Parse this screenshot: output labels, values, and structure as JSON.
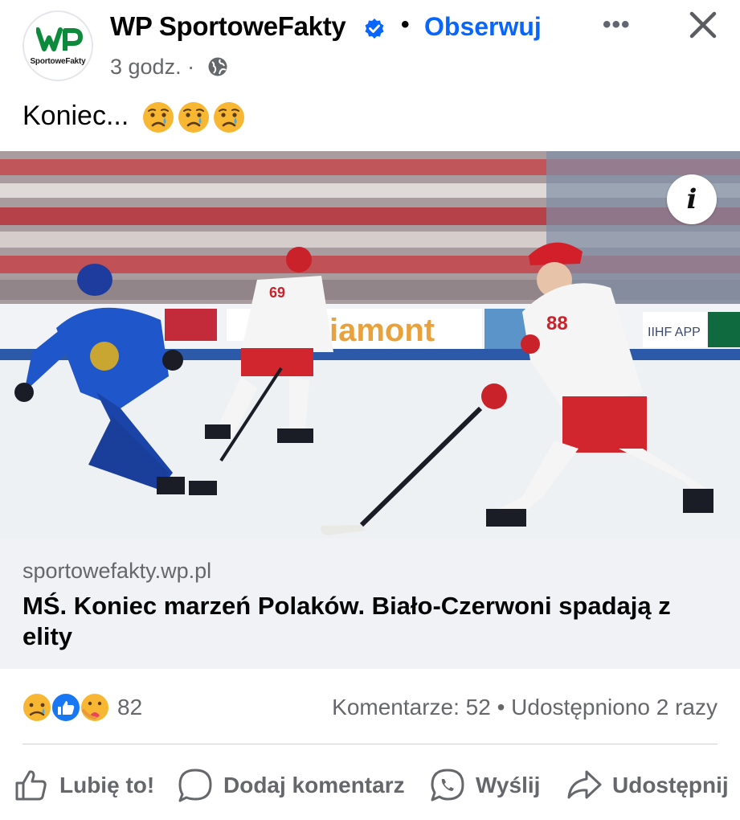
{
  "header": {
    "avatar_brand": "WP",
    "avatar_caption": "SportoweFakty",
    "page_name": "WP SportoweFakty",
    "separator": "•",
    "follow_label": "Obserwuj",
    "more_label": "•••",
    "timestamp": "3 godz. ·"
  },
  "post": {
    "text": "Koniec...",
    "emojis": [
      "crying-face",
      "crying-face",
      "crying-face"
    ]
  },
  "image": {
    "info_label": "i",
    "board_text": "iamont",
    "iihf_text": "IIHF APP",
    "jersey_left": "69",
    "jersey_right": "88"
  },
  "link": {
    "domain": "sportowefakty.wp.pl",
    "headline": "MŚ. Koniec marzeń Polaków. Biało-Czerwoni spadają z elity"
  },
  "stats": {
    "reactions": [
      "sad",
      "like",
      "care"
    ],
    "reaction_count": "82",
    "comments_shares": "Komentarze: 52 • Udostępniono 2 razy"
  },
  "actions": {
    "like": "Lubię to!",
    "comment": "Dodaj komentarz",
    "send": "Wyślij",
    "share": "Udostępnij"
  },
  "colors": {
    "accent": "#0866ff",
    "secondary_text": "#65676b",
    "link_bg": "#f0f2f5",
    "brand_green": "#0e8a3c"
  }
}
